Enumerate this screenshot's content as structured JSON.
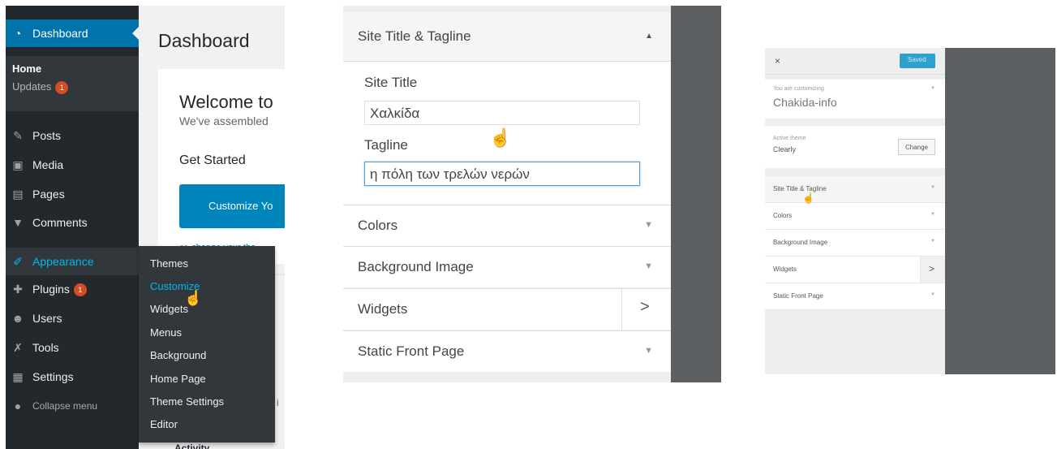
{
  "admin": {
    "menu": {
      "dashboard": "Dashboard",
      "home": "Home",
      "updates": "Updates",
      "updates_count": "1",
      "posts": "Posts",
      "media": "Media",
      "pages": "Pages",
      "comments": "Comments",
      "appearance": "Appearance",
      "plugins": "Plugins",
      "plugins_count": "1",
      "users": "Users",
      "tools": "Tools",
      "settings": "Settings",
      "collapse": "Collapse menu"
    },
    "flyout": [
      "Themes",
      "Customize",
      "Widgets",
      "Menus",
      "Background",
      "Home Page",
      "Theme Settings",
      "Editor"
    ],
    "content": {
      "title": "Dashboard",
      "welcome": "Welcome to",
      "welcome_sub": "We've assembled",
      "get_started": "Get Started",
      "customize_btn": "Customize Yo",
      "or": "or,",
      "change_theme": "change your the",
      "partial_i": "i",
      "activity": "Activity"
    }
  },
  "customizer": {
    "section_title": "Site Title & Tagline",
    "site_title_label": "Site Title",
    "site_title_value": "Χαλκίδα",
    "tagline_label": "Tagline",
    "tagline_value": "η πόλη των τρελών νερών",
    "sections": [
      "Colors",
      "Background Image",
      "Widgets",
      "Static Front Page"
    ],
    "arrow_up": "▲",
    "arrow_down": "▼",
    "chevron_right": ">"
  },
  "mini": {
    "close": "×",
    "save": "Saved",
    "customizing_label": "You are customizing",
    "site_name": "Chakida-info",
    "active_theme_label": "Active theme",
    "active_theme": "Clearly",
    "change": "Change",
    "sections": [
      "Site Title & Tagline",
      "Colors",
      "Background Image",
      "Widgets",
      "Static Front Page"
    ]
  },
  "colors": {
    "sidebar_bg": "#23282d",
    "accent": "#0073aa",
    "highlight": "#00b9eb",
    "badge": "#d54e21"
  }
}
